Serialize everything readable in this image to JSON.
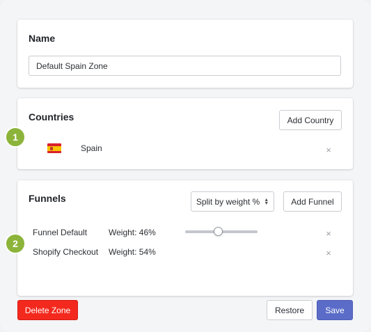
{
  "name_section": {
    "title": "Name",
    "input_value": "Default Spain Zone"
  },
  "countries_section": {
    "title": "Countries",
    "add_button_label": "Add Country",
    "items": [
      {
        "name": "Spain",
        "flag_icon": "spain-flag-icon",
        "remove_icon": "×"
      }
    ]
  },
  "funnels_section": {
    "title": "Funnels",
    "split_select_value": "Split by weight %",
    "add_button_label": "Add Funnel",
    "items": [
      {
        "name": "Funnel Default",
        "weight": "Weight: 46%",
        "weight_value": 46,
        "remove_icon": "×"
      },
      {
        "name": "Shopify Checkout",
        "weight": "Weight: 54%",
        "weight_value": 54,
        "remove_icon": "×"
      }
    ]
  },
  "badges": [
    "1",
    "2"
  ],
  "footer": {
    "delete_label": "Delete Zone",
    "restore_label": "Restore",
    "save_label": "Save"
  },
  "colors": {
    "badge": "#8cb43a",
    "delete": "#f4291e",
    "save": "#5a6cc8"
  }
}
